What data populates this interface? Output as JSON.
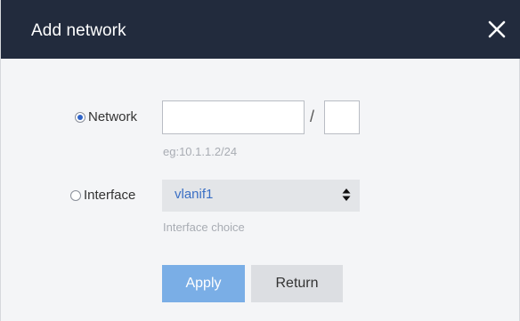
{
  "dialog": {
    "title": "Add network",
    "close_icon": "close-icon"
  },
  "network_option": {
    "label": "Network",
    "selected": true,
    "address_value": "",
    "prefix_value": "",
    "separator": "/",
    "hint": "eg:10.1.1.2/24"
  },
  "interface_option": {
    "label": "Interface",
    "selected": false,
    "select_value": "vlanif1",
    "hint": "Interface choice",
    "arrow_icon": "sort-arrows-icon"
  },
  "buttons": {
    "apply_label": "Apply",
    "return_label": "Return"
  },
  "colors": {
    "titlebar": "#222b3d",
    "apply_button": "#7aaee6",
    "select_text": "#3a6fc4"
  }
}
